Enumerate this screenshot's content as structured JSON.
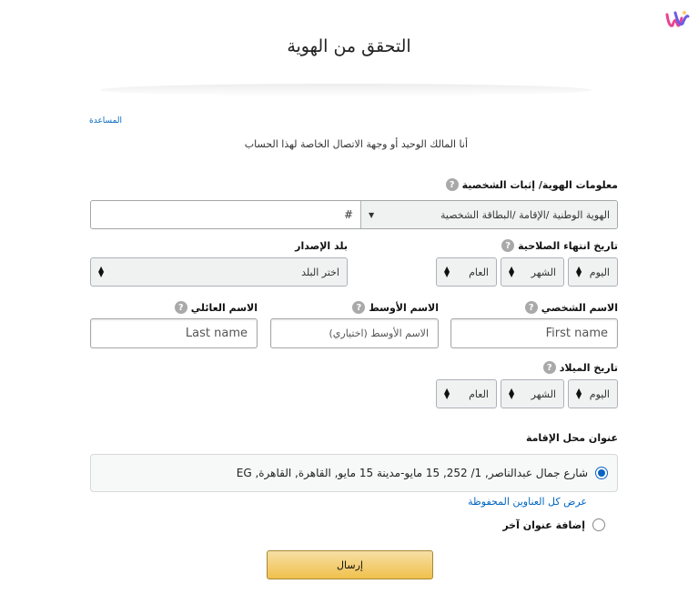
{
  "page": {
    "title": "التحقق من الهوية",
    "help": "المساعدة",
    "subtitle": "أنا المالك الوحيد أو وجهة الاتصال الخاصة لهذا الحساب"
  },
  "identity": {
    "label": "معلومات الهوية/ إثبات الشخصية",
    "doc_type": "الهوية الوطنية /الإقامة /البطاقة الشخصية",
    "number_placeholder": "#"
  },
  "issuing_country": {
    "label": "بلد الإصدار",
    "value": "اختر البلد"
  },
  "expiry": {
    "label": "تاريخ انتهاء الصلاحية",
    "day": "اليوم",
    "month": "الشهر",
    "year": "العام"
  },
  "names": {
    "first_label": "الاسم الشخصي",
    "first_placeholder": "First name",
    "middle_label": "الاسم الأوسط",
    "middle_placeholder": "الاسم الأوسط (اختياري)",
    "last_label": "الاسم العائلي",
    "last_placeholder": "Last name"
  },
  "birth": {
    "label": "تاريخ الميلاد",
    "day": "اليوم",
    "month": "الشهر",
    "year": "العام"
  },
  "address": {
    "label": "عنوان محل الإقامة",
    "selected": "شارع جمال عبدالناصر, 1/ 252, 15 مايو-مدينة 15 مايو, القاهرة, القاهرة, EG",
    "view_all": "عرض كل العناوين المحفوظة",
    "add_other": "إضافة عنوان آخر"
  },
  "submit_label": "إرسال",
  "help_icon_glyph": "?",
  "colors": {
    "link": "#0066c0",
    "radio": "#0a64c2",
    "button_top": "#f7dfa5",
    "button_bottom": "#f0c14b"
  }
}
